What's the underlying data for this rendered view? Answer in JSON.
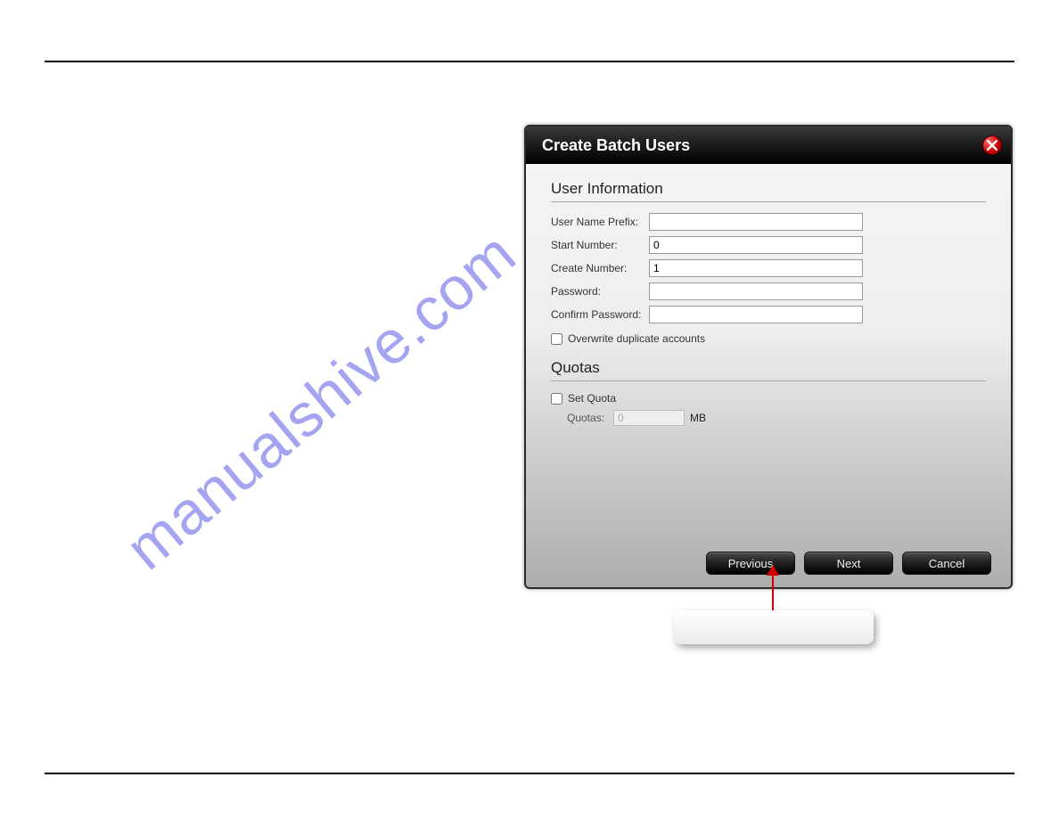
{
  "watermark": "manualshive.com",
  "dialog": {
    "title": "Create Batch Users",
    "sections": {
      "user_info": {
        "heading": "User Information",
        "fields": {
          "prefix_label": "User Name Prefix:",
          "prefix_value": "",
          "start_label": "Start Number:",
          "start_value": "0",
          "create_label": "Create Number:",
          "create_value": "1",
          "password_label": "Password:",
          "password_value": "",
          "confirm_label": "Confirm Password:",
          "confirm_value": ""
        },
        "overwrite_label": "Overwrite duplicate accounts"
      },
      "quotas": {
        "heading": "Quotas",
        "set_quota_label": "Set Quota",
        "quotas_label": "Quotas:",
        "quotas_value": "0",
        "unit": "MB"
      }
    },
    "buttons": {
      "previous": "Previous",
      "next": "Next",
      "cancel": "Cancel"
    }
  }
}
